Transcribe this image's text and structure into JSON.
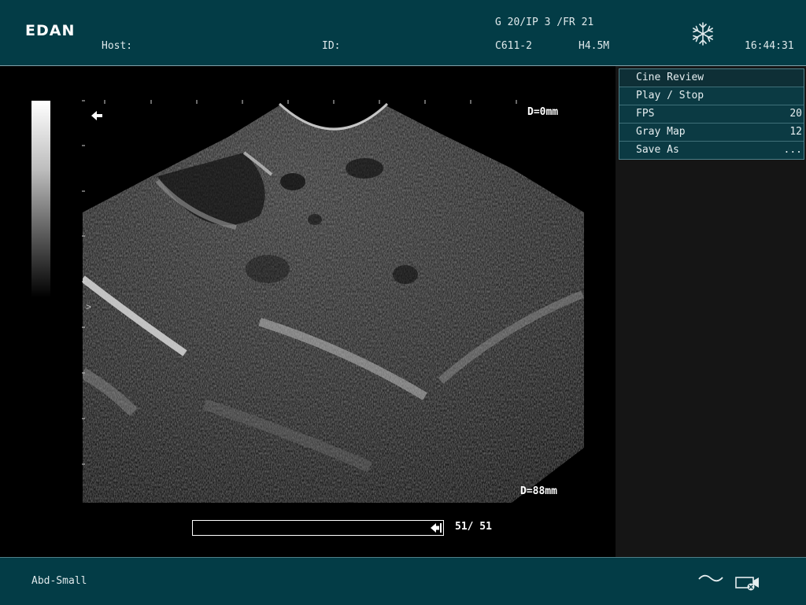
{
  "header": {
    "brand": "EDAN",
    "host_label": "Host:",
    "id_label": "ID:",
    "params": "G 20/IP 3 /FR 21",
    "probe": "C611-2",
    "frequency": "H4.5M",
    "time": "16:44:31",
    "freeze_icon": "snowflake-icon"
  },
  "image": {
    "depth_top": "D=0mm",
    "depth_bottom": "D=88mm",
    "focus_marker": ">",
    "direction_icon": "arrow-left-icon"
  },
  "cine": {
    "frame_display": "51/ 51",
    "progress": 1.0,
    "end_icon": "arrow-to-end-icon"
  },
  "menu": {
    "title": "Cine Review",
    "items": [
      {
        "label": "Play / Stop",
        "value": ""
      },
      {
        "label": "FPS",
        "value": "20"
      },
      {
        "label": "Gray Map",
        "value": "12"
      },
      {
        "label": "Save As",
        "value": "..."
      }
    ]
  },
  "footer": {
    "preset": "Abd-Small",
    "wave_icon": "wave-icon",
    "record_icon": "video-record-icon"
  },
  "colors": {
    "panel": "#033c46",
    "menu_bg": "#0b3a43",
    "menu_border": "#4f7f88"
  }
}
